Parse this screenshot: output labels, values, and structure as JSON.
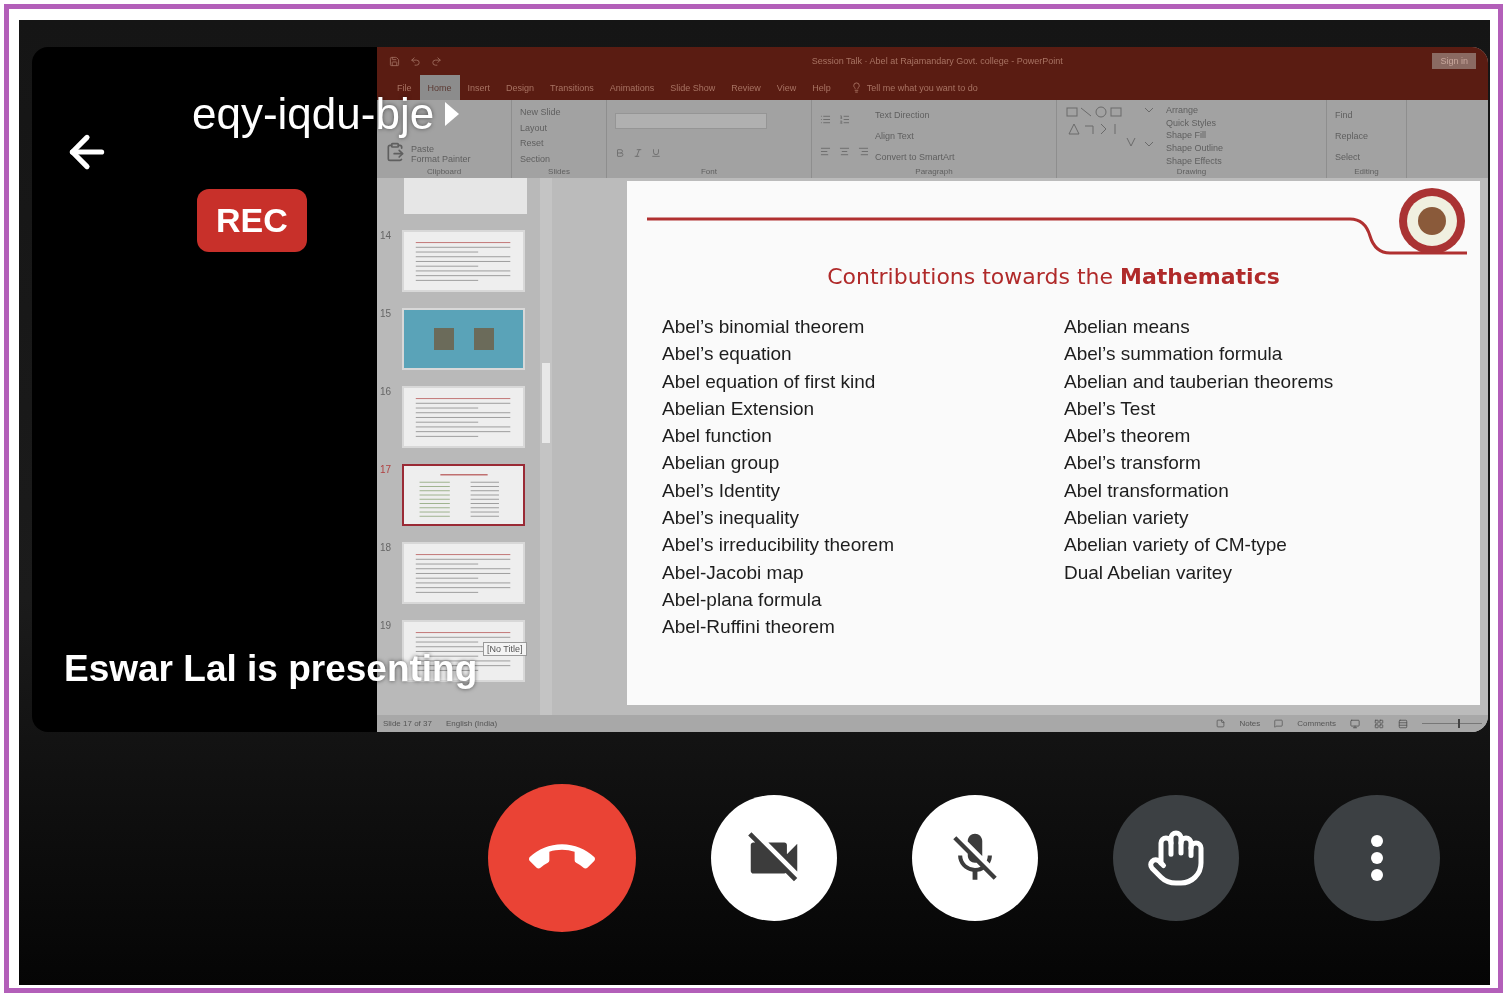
{
  "meeting": {
    "code": "eqy-iqdu-bje",
    "recording_badge": "REC",
    "presenter_caption": "Eswar Lal is presenting"
  },
  "powerpoint": {
    "title": "Session Talk · Abel at Rajamandary Govt. college - PowerPoint",
    "sign_in": "Sign in",
    "tabs": [
      {
        "label": "File",
        "selected": false
      },
      {
        "label": "Home",
        "selected": true
      },
      {
        "label": "Insert",
        "selected": false
      },
      {
        "label": "Design",
        "selected": false
      },
      {
        "label": "Transitions",
        "selected": false
      },
      {
        "label": "Animations",
        "selected": false
      },
      {
        "label": "Slide Show",
        "selected": false
      },
      {
        "label": "Review",
        "selected": false
      },
      {
        "label": "View",
        "selected": false
      },
      {
        "label": "Help",
        "selected": false
      }
    ],
    "tell_me": "Tell me what you want to do",
    "ribbon_groups": [
      {
        "kind": "clipboard",
        "label": "Clipboard",
        "commands": [
          "Paste",
          "Format Painter"
        ]
      },
      {
        "kind": "slides",
        "label": "Slides",
        "commands": [
          "New Slide",
          "Layout",
          "Reset",
          "Section"
        ]
      },
      {
        "kind": "font",
        "label": "Font"
      },
      {
        "kind": "paragraph",
        "label": "Paragraph",
        "commands": [
          "Text Direction",
          "Align Text",
          "Convert to SmartArt"
        ]
      },
      {
        "kind": "drawing",
        "label": "Drawing",
        "commands": [
          "Arrange",
          "Quick Styles",
          "Shape Fill",
          "Shape Outline",
          "Shape Effects"
        ]
      },
      {
        "kind": "editing",
        "label": "Editing",
        "commands": [
          "Find",
          "Replace",
          "Select"
        ]
      }
    ],
    "thumbnails": [
      {
        "number": "14",
        "kind": "text",
        "selected": false
      },
      {
        "number": "15",
        "kind": "photo",
        "selected": false
      },
      {
        "number": "16",
        "kind": "text",
        "selected": false
      },
      {
        "number": "17",
        "kind": "list",
        "selected": true
      },
      {
        "number": "18",
        "kind": "text",
        "selected": false
      },
      {
        "number": "19",
        "kind": "text",
        "selected": false
      }
    ],
    "tooltip": "[No Title]",
    "slide": {
      "title": "Contributions towards the **Mathematics**",
      "left_items": [
        "Abel’s binomial theorem",
        "Abel’s equation",
        "Abel equation of first kind",
        "Abelian Extension",
        "Abel function",
        "Abelian group",
        "Abel’s Identity",
        "Abel’s inequality",
        "Abel’s irreducibility theorem",
        "Abel-Jacobi map",
        "Abel-plana formula",
        "Abel-Ruffini theorem"
      ],
      "right_items": [
        "Abelian means",
        "Abel’s summation formula",
        "Abelian and tauberian theorems",
        "Abel’s Test",
        "Abel’s theorem",
        "Abel’s transform",
        "Abel transformation",
        "Abelian variety",
        "Abelian variety of CM-type",
        "Dual Abelian varitey"
      ]
    },
    "status_bar": {
      "slide_position": "Slide 17 of 37",
      "language": "English (India)",
      "notes": "Notes",
      "comments": "Comments",
      "zoom": {
        "level": 0.6
      }
    }
  },
  "controls": [
    {
      "kind": "hangup"
    },
    {
      "kind": "camera",
      "on": false
    },
    {
      "kind": "microphone",
      "on": false
    },
    {
      "kind": "raise_hand"
    },
    {
      "kind": "more"
    }
  ]
}
